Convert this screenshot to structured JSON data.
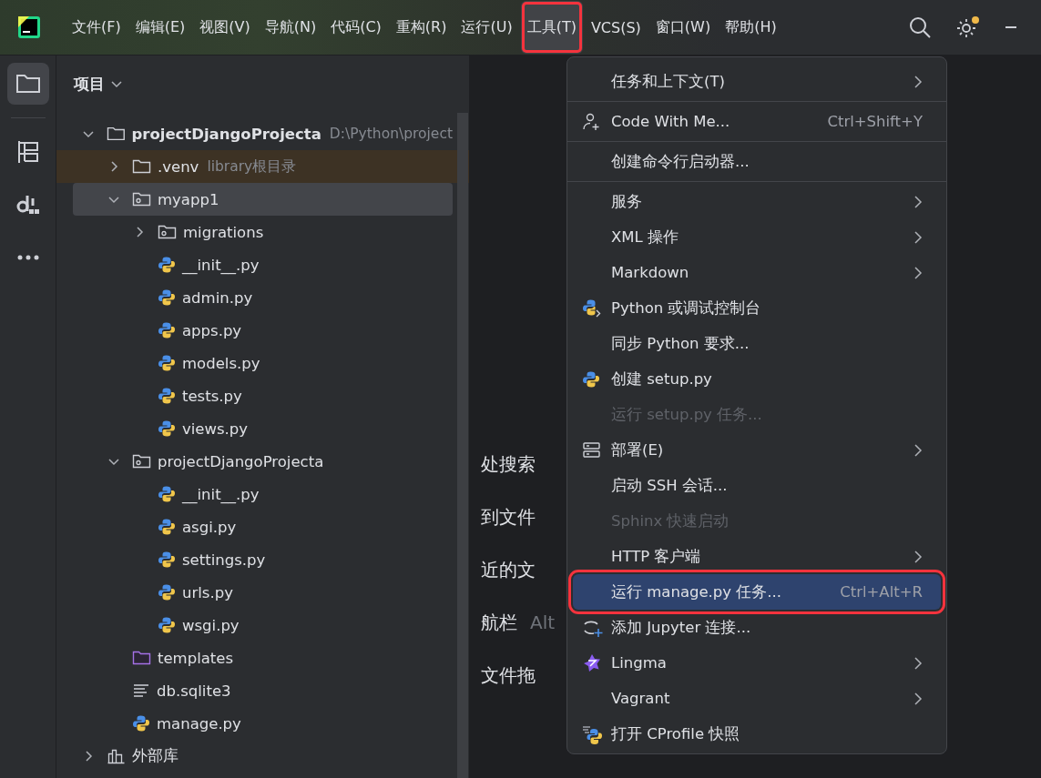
{
  "title_bar": {
    "menu": [
      {
        "label": "文件(F)",
        "selected": false,
        "annotated": false
      },
      {
        "label": "编辑(E)",
        "selected": false,
        "annotated": false
      },
      {
        "label": "视图(V)",
        "selected": false,
        "annotated": false
      },
      {
        "label": "导航(N)",
        "selected": false,
        "annotated": false
      },
      {
        "label": "代码(C)",
        "selected": false,
        "annotated": false
      },
      {
        "label": "重构(R)",
        "selected": false,
        "annotated": false
      },
      {
        "label": "运行(U)",
        "selected": false,
        "annotated": false
      },
      {
        "label": "工具(T)",
        "selected": true,
        "annotated": true
      },
      {
        "label": "VCS(S)",
        "selected": false,
        "annotated": false
      },
      {
        "label": "窗口(W)",
        "selected": false,
        "annotated": false
      },
      {
        "label": "帮助(H)",
        "selected": false,
        "annotated": false
      }
    ],
    "notification": true
  },
  "tool_strip": [
    {
      "kind": "project",
      "selected": true
    },
    {
      "kind": "structure",
      "selected": false
    },
    {
      "kind": "packages",
      "selected": false
    },
    {
      "kind": "more",
      "selected": false
    }
  ],
  "project_panel": {
    "title": "项目",
    "tree": [
      {
        "kind": "root",
        "label": "projectDjangoProjecta",
        "hint": "D:\\Python\\project",
        "expanded": true,
        "selected": false,
        "children": [
          {
            "kind": "venv",
            "label": ".venv",
            "hint": "library根目录",
            "expanded": false,
            "selected": false
          },
          {
            "kind": "package",
            "label": "myapp1",
            "expanded": true,
            "selected": true,
            "children": [
              {
                "kind": "package",
                "label": "migrations",
                "expanded": false,
                "selected": false
              },
              {
                "kind": "python",
                "label": "__init__.py",
                "selected": false
              },
              {
                "kind": "python",
                "label": "admin.py",
                "selected": false
              },
              {
                "kind": "python",
                "label": "apps.py",
                "selected": false
              },
              {
                "kind": "python",
                "label": "models.py",
                "selected": false
              },
              {
                "kind": "python",
                "label": "tests.py",
                "selected": false
              },
              {
                "kind": "python",
                "label": "views.py",
                "selected": false
              }
            ]
          },
          {
            "kind": "package",
            "label": "projectDjangoProjecta",
            "expanded": true,
            "selected": false,
            "children": [
              {
                "kind": "python",
                "label": "__init__.py",
                "selected": false
              },
              {
                "kind": "python",
                "label": "asgi.py",
                "selected": false
              },
              {
                "kind": "python",
                "label": "settings.py",
                "selected": false
              },
              {
                "kind": "python",
                "label": "urls.py",
                "selected": false
              },
              {
                "kind": "python",
                "label": "wsgi.py",
                "selected": false
              }
            ]
          },
          {
            "kind": "templates",
            "label": "templates",
            "selected": false
          },
          {
            "kind": "text",
            "label": "db.sqlite3",
            "selected": false
          },
          {
            "kind": "python",
            "label": "manage.py",
            "selected": false
          }
        ]
      },
      {
        "kind": "library",
        "label": "外部库",
        "expanded": false,
        "selected": false
      }
    ]
  },
  "editor_hints": [
    {
      "label": "处搜索"
    },
    {
      "label": "到文件"
    },
    {
      "label": "近的文"
    },
    {
      "label": "航栏",
      "shortcut": "Alt"
    },
    {
      "label": "文件拖"
    }
  ],
  "menu": {
    "items": [
      {
        "kind": "plain",
        "label": "任务和上下文(T)",
        "submenu": true,
        "disabled": false,
        "selected": false,
        "annotated": false
      },
      {
        "kind": "separator"
      },
      {
        "kind": "collab",
        "label": "Code With Me...",
        "shortcut": "Ctrl+Shift+Y",
        "submenu": false,
        "disabled": false,
        "selected": false,
        "annotated": false
      },
      {
        "kind": "separator"
      },
      {
        "kind": "plain",
        "label": "创建命令行启动器...",
        "submenu": false,
        "disabled": false,
        "selected": false,
        "annotated": false
      },
      {
        "kind": "separator"
      },
      {
        "kind": "plain",
        "label": "服务",
        "submenu": true,
        "disabled": false,
        "selected": false,
        "annotated": false
      },
      {
        "kind": "plain",
        "label": "XML 操作",
        "submenu": true,
        "disabled": false,
        "selected": false,
        "annotated": false
      },
      {
        "kind": "plain",
        "label": "Markdown",
        "submenu": true,
        "disabled": false,
        "selected": false,
        "annotated": false
      },
      {
        "kind": "console",
        "label": "Python 或调试控制台",
        "submenu": false,
        "disabled": false,
        "selected": false,
        "annotated": false
      },
      {
        "kind": "plain",
        "label": "同步 Python 要求...",
        "submenu": false,
        "disabled": false,
        "selected": false,
        "annotated": false
      },
      {
        "kind": "python",
        "label": "创建 setup.py",
        "submenu": false,
        "disabled": false,
        "selected": false,
        "annotated": false
      },
      {
        "kind": "plain",
        "label": "运行 setup.py 任务...",
        "submenu": false,
        "disabled": true,
        "selected": false,
        "annotated": false
      },
      {
        "kind": "deploy",
        "label": "部署(E)",
        "submenu": true,
        "disabled": false,
        "selected": false,
        "annotated": false
      },
      {
        "kind": "plain",
        "label": "启动 SSH 会话...",
        "submenu": false,
        "disabled": false,
        "selected": false,
        "annotated": false
      },
      {
        "kind": "plain",
        "label": "Sphinx 快速启动",
        "submenu": false,
        "disabled": true,
        "selected": false,
        "annotated": false
      },
      {
        "kind": "plain",
        "label": "HTTP 客户端",
        "submenu": true,
        "disabled": false,
        "selected": false,
        "annotated": false
      },
      {
        "kind": "plain",
        "label": "运行 manage.py 任务...",
        "shortcut": "Ctrl+Alt+R",
        "submenu": false,
        "disabled": false,
        "selected": true,
        "annotated": true
      },
      {
        "kind": "jupyter",
        "label": "添加 Jupyter 连接...",
        "submenu": false,
        "disabled": false,
        "selected": false,
        "annotated": false
      },
      {
        "kind": "lingma",
        "label": "Lingma",
        "submenu": true,
        "disabled": false,
        "selected": false,
        "annotated": false
      },
      {
        "kind": "plain",
        "label": "Vagrant",
        "submenu": true,
        "disabled": false,
        "selected": false,
        "annotated": false
      },
      {
        "kind": "profile",
        "label": "打开 CProfile 快照",
        "submenu": false,
        "disabled": false,
        "selected": false,
        "annotated": false
      }
    ]
  }
}
